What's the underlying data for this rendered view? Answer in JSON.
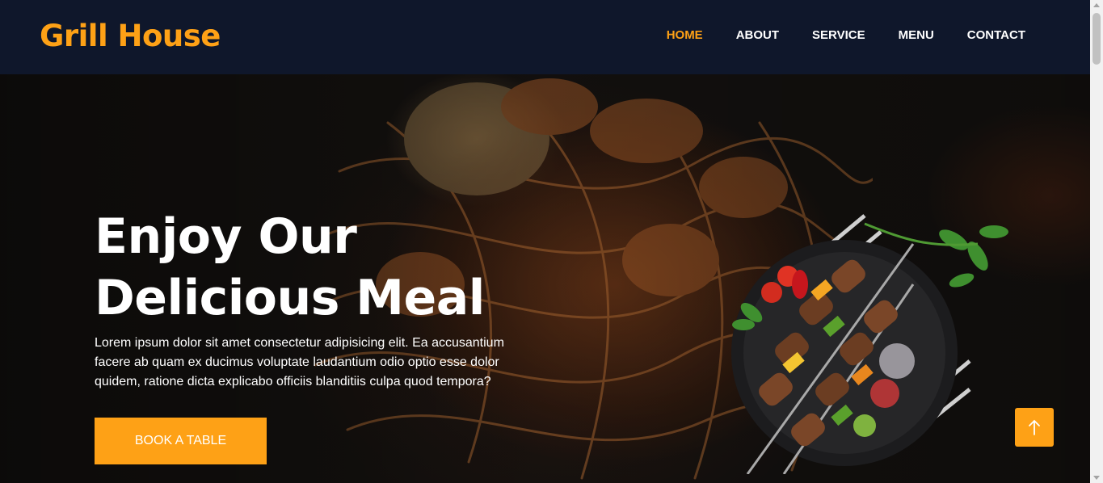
{
  "brand": {
    "name": "Grill House"
  },
  "nav": {
    "items": [
      {
        "label": "HOME",
        "active": true
      },
      {
        "label": "ABOUT",
        "active": false
      },
      {
        "label": "SERVICE",
        "active": false
      },
      {
        "label": "MENU",
        "active": false
      },
      {
        "label": "CONTACT",
        "active": false
      }
    ]
  },
  "hero": {
    "title_line1": "Enjoy Our",
    "title_line2": "Delicious Meal",
    "description": "Lorem ipsum dolor sit amet consectetur adipisicing elit. Ea accusantium facere ab quam ex ducimus voluptate laudantium odio optio esse dolor quidem, ratione dicta explicabo officiis blanditiis culpa quod tempora?",
    "cta_label": "BOOK A TABLE"
  },
  "icons": {
    "back_to_top": "arrow-up-icon"
  },
  "colors": {
    "accent": "#fea116",
    "navbar": "#0f172b",
    "text": "#ffffff"
  }
}
